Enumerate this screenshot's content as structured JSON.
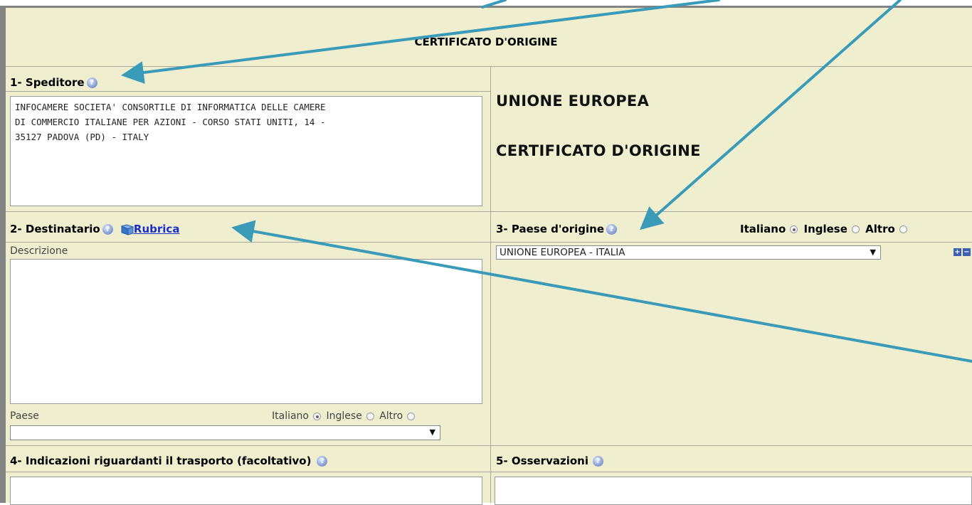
{
  "header": {
    "title": "CERTIFICATO D'ORIGINE"
  },
  "speditore": {
    "label": "1- Speditore",
    "text": "INFOCAMERE SOCIETA' CONSORTILE DI INFORMATICA DELLE CAMERE\nDI COMMERCIO ITALIANE PER AZIONI - CORSO STATI UNITI, 14 -\n35127 PADOVA (PD) - ITALY"
  },
  "right_panel": {
    "line1": "UNIONE EUROPEA",
    "line2": "CERTIFICATO D'ORIGINE"
  },
  "destinatario": {
    "label": "2- Destinatario",
    "rubrica_link": "Rubrica",
    "descrizione_label": "Descrizione",
    "descrizione_value": "",
    "paese_label": "Paese",
    "paese_value": "",
    "lang_options": [
      "Italiano",
      "Inglese",
      "Altro"
    ],
    "lang_selected": "Italiano"
  },
  "paese_origine": {
    "label": "3- Paese d'origine",
    "lang_options": [
      "Italiano",
      "Inglese",
      "Altro"
    ],
    "lang_selected": "Italiano",
    "select_value": "UNIONE EUROPEA - ITALIA"
  },
  "trasporto": {
    "label": "4- Indicazioni riguardanti il trasporto (facoltativo)",
    "value": ""
  },
  "osservazioni": {
    "label": "5- Osservazioni",
    "value": ""
  },
  "icons": {
    "help": "help-icon",
    "book": "address-book-icon",
    "add": "plus-icon",
    "remove": "minus-icon",
    "dropdown": "dropdown-arrow-icon"
  },
  "colors": {
    "panel_bg": "#efefd0",
    "frame_border": "#838383",
    "annotation_arrow": "#3a9bb8",
    "link": "#1a2ecc"
  }
}
